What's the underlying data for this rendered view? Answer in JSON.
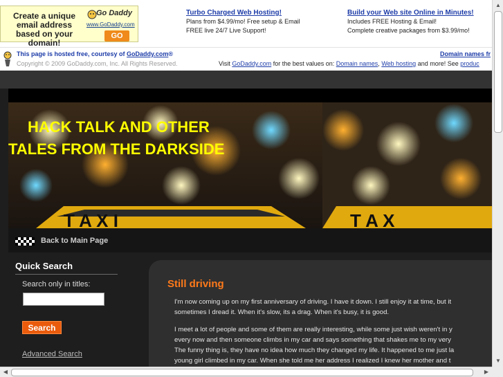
{
  "ad": {
    "box_text": "Create a unique email address based on your domain!",
    "logo_text": "Go Daddy",
    "logo_url": "www.GoDaddy.com",
    "go_label": "GO",
    "col1": {
      "heading": "Turbo Charged Web Hosting!",
      "line1": "Plans from $4.99/mo! Free setup & Email",
      "line2": "FREE live 24/7 Live Support!"
    },
    "col2": {
      "heading": "Build your Web site Online in Minutes!",
      "line1": "Includes FREE Hosting & Email!",
      "line2": "Complete creative packages from $3.99/mo!"
    }
  },
  "hosted": {
    "line1_prefix": "This page is hosted free, courtesy of ",
    "line1_link": "GoDaddy.com",
    "line1_suffix": "®",
    "copyright": "Copyright © 2009 GoDaddy.com, Inc. All Rights Reserved.",
    "right_link": "Domain names fr",
    "visit_prefix": "Visit ",
    "visit_link": "GoDaddy.com",
    "visit_mid": " for the best values on: ",
    "visit_link2": "Domain names",
    "visit_sep": ", ",
    "visit_link3": "Web hosting",
    "visit_mid2": " and more! See ",
    "visit_link4": "produc"
  },
  "banner": {
    "title_line1": "HACK TALK AND OTHER",
    "title_line2": "TALES FROM THE DARKSIDE"
  },
  "nav": {
    "back_label": "Back to Main Page"
  },
  "sidebar": {
    "heading": "Quick Search",
    "search_label": "Search only in titles:",
    "search_value": "",
    "search_button": "Search",
    "advanced_link": "Advanced Search"
  },
  "post": {
    "title": "Still driving",
    "p1_l1": "I'm now coming up on my first anniversary of driving. I have it down. I still enjoy it at time, but it",
    "p1_l2": "sometimes I dread it. When it's slow, its a drag. When it's busy, it is good.",
    "p2_l1": "I meet a lot of people and some of them are really interesting, while some just wish weren't in y",
    "p2_l2": "every now and then someone climbs in my car and says something that shakes me to my very",
    "p2_l3": "The funny thing is, they have no idea how much they changed my life. It happened to me just la",
    "p2_l4": "young girl climbed in my car. When she told me her address I realized I knew her mother and t"
  }
}
